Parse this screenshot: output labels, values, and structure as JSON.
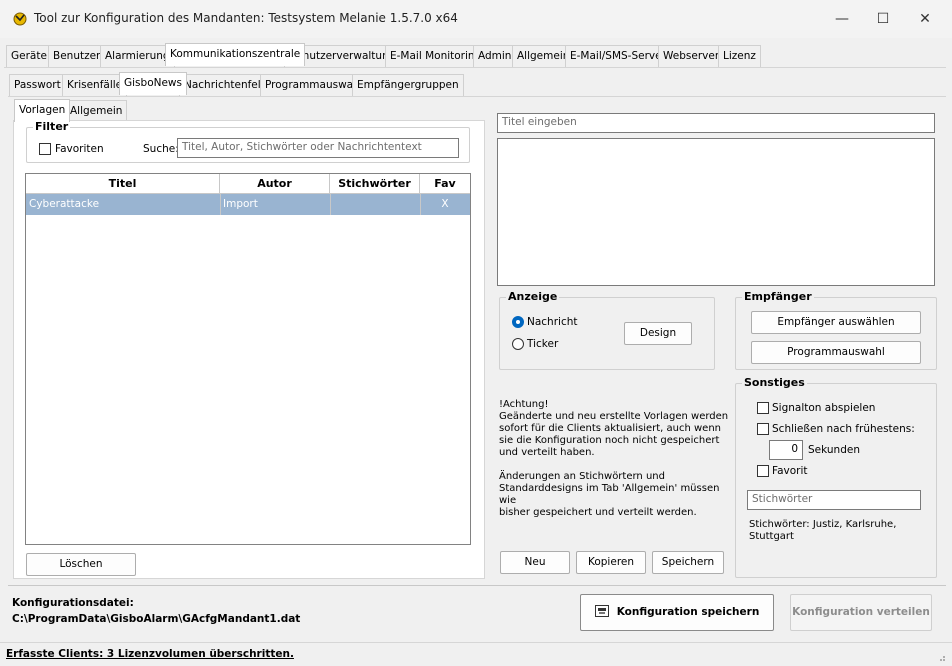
{
  "window": {
    "title": "Tool zur Konfiguration des Mandanten: Testsystem Melanie 1.5.7.0 x64",
    "minimize": "—",
    "maximize": "☐",
    "close": "✕"
  },
  "main_tabs": [
    "Geräte",
    "Benutzer",
    "Alarmierung",
    "Kommunikationszentrale",
    "Benutzerverwaltung",
    "E-Mail Monitoring",
    "Admin",
    "Allgemein",
    "E-Mail/SMS-Server",
    "Webserver",
    "Lizenz"
  ],
  "sub_tabs": [
    "Passwort",
    "Krisenfälle",
    "GisboNews",
    "Nachrichtenfeld",
    "Programmauswahl",
    "Empfängergruppen"
  ],
  "inner_tabs": [
    "Vorlagen",
    "Allgemein"
  ],
  "filter": {
    "title": "Filter",
    "favorites_label": "Favoriten",
    "search_label": "Suche:",
    "search_placeholder": "Titel, Autor, Stichwörter oder Nachrichtentext"
  },
  "table": {
    "columns": [
      "Titel",
      "Autor",
      "Stichwörter",
      "Fav"
    ],
    "rows": [
      {
        "titel": "Cyberattacke",
        "autor": "Import",
        "stichwoerter": "",
        "fav": "X"
      }
    ]
  },
  "delete_button": "Löschen",
  "title_input_placeholder": "Titel eingeben",
  "anzeige": {
    "title": "Anzeige",
    "option_nachricht": "Nachricht",
    "option_ticker": "Ticker",
    "design_button": "Design"
  },
  "empfaenger": {
    "title": "Empfänger",
    "select_button": "Empfänger auswählen",
    "program_button": "Programmauswahl"
  },
  "warning": {
    "p1": "!Achtung!\nGeänderte und neu erstellte Vorlagen werden\nsofort für die Clients aktualisiert, auch wenn\nsie die Konfiguration noch nicht gespeichert\nund verteilt haben.",
    "p2": "Änderungen an Stichwörtern und\nStandarddesigns im Tab 'Allgemein' müssen wie\nbisher gespeichert und verteilt werden."
  },
  "sonstiges": {
    "title": "Sonstiges",
    "signalton": "Signalton abspielen",
    "schliessen": "Schließen nach frühestens:",
    "seconds_value": "0",
    "seconds_label": "Sekunden",
    "favorit": "Favorit",
    "keywords_placeholder": "Stichwörter",
    "keywords_text": "Stichwörter: Justiz, Karlsruhe,\nStuttgart"
  },
  "action_buttons": {
    "neu": "Neu",
    "kopieren": "Kopieren",
    "speichern": "Speichern"
  },
  "config": {
    "label": "Konfigurationsdatei:",
    "path": "C:\\ProgramData\\GisboAlarm\\GAcfgMandant1.dat",
    "save_button": "Konfiguration speichern",
    "distribute_button": "Konfiguration verteilen"
  },
  "status": {
    "text": "Erfasste Clients: 3 Lizenzvolumen überschritten."
  },
  "colors": {
    "selection": "#99b4d1",
    "accent": "#0067c0"
  }
}
